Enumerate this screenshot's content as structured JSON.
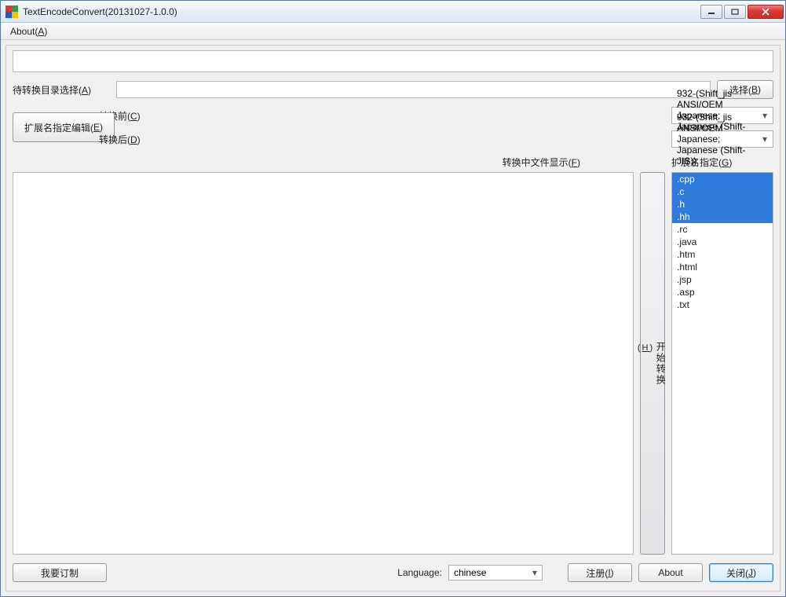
{
  "window": {
    "title": "TextEncodeConvert(20131027-1.0.0)"
  },
  "menu": {
    "about": "About(",
    "about_hk": "A",
    "about_tail": ")"
  },
  "dir": {
    "label_pre": "待转换目录选择(",
    "label_hk": "A",
    "label_tail": ")",
    "value": "",
    "btn_pre": "选择(",
    "btn_hk": "B",
    "btn_tail": ")"
  },
  "before": {
    "label_pre": "转换前(",
    "label_hk": "C",
    "label_tail": ")",
    "value": "932-(Shift_jis ANSI/OEM Japanese; Japanese (Shift-JIS))"
  },
  "after": {
    "label_pre": "转换后(",
    "label_hk": "D",
    "label_tail": ")",
    "value": "932-(Shift_jis ANSI/OEM Japanese; Japanese (Shift-JIS))"
  },
  "extedit": {
    "pre": "扩展名指定编辑(",
    "hk": "E",
    "tail": ")"
  },
  "midlabels": {
    "center_pre": "转换中文件显示(",
    "center_hk": "F",
    "center_tail": ")",
    "right_pre": "扩展名指定(",
    "right_hk": "G",
    "right_tail": ")"
  },
  "start": {
    "text": "开始转换",
    "hk_pre": "(",
    "hk": "H",
    "hk_tail": ")"
  },
  "exts": {
    "items": [
      {
        "label": ".cpp",
        "selected": true
      },
      {
        "label": ".c",
        "selected": true
      },
      {
        "label": ".h",
        "selected": true
      },
      {
        "label": ".hh",
        "selected": true
      },
      {
        "label": ".rc",
        "selected": false
      },
      {
        "label": ".java",
        "selected": false
      },
      {
        "label": ".htm",
        "selected": false
      },
      {
        "label": ".html",
        "selected": false
      },
      {
        "label": ".jsp",
        "selected": false
      },
      {
        "label": ".asp",
        "selected": false
      },
      {
        "label": ".txt",
        "selected": false
      }
    ]
  },
  "footer": {
    "subscribe": "我要订制",
    "lang_label": "Language:",
    "lang_value": "chinese",
    "register_pre": "注册(",
    "register_hk": "I",
    "register_tail": ")",
    "about": "About",
    "close_pre": "关闭(",
    "close_hk": "J",
    "close_tail": ")"
  }
}
